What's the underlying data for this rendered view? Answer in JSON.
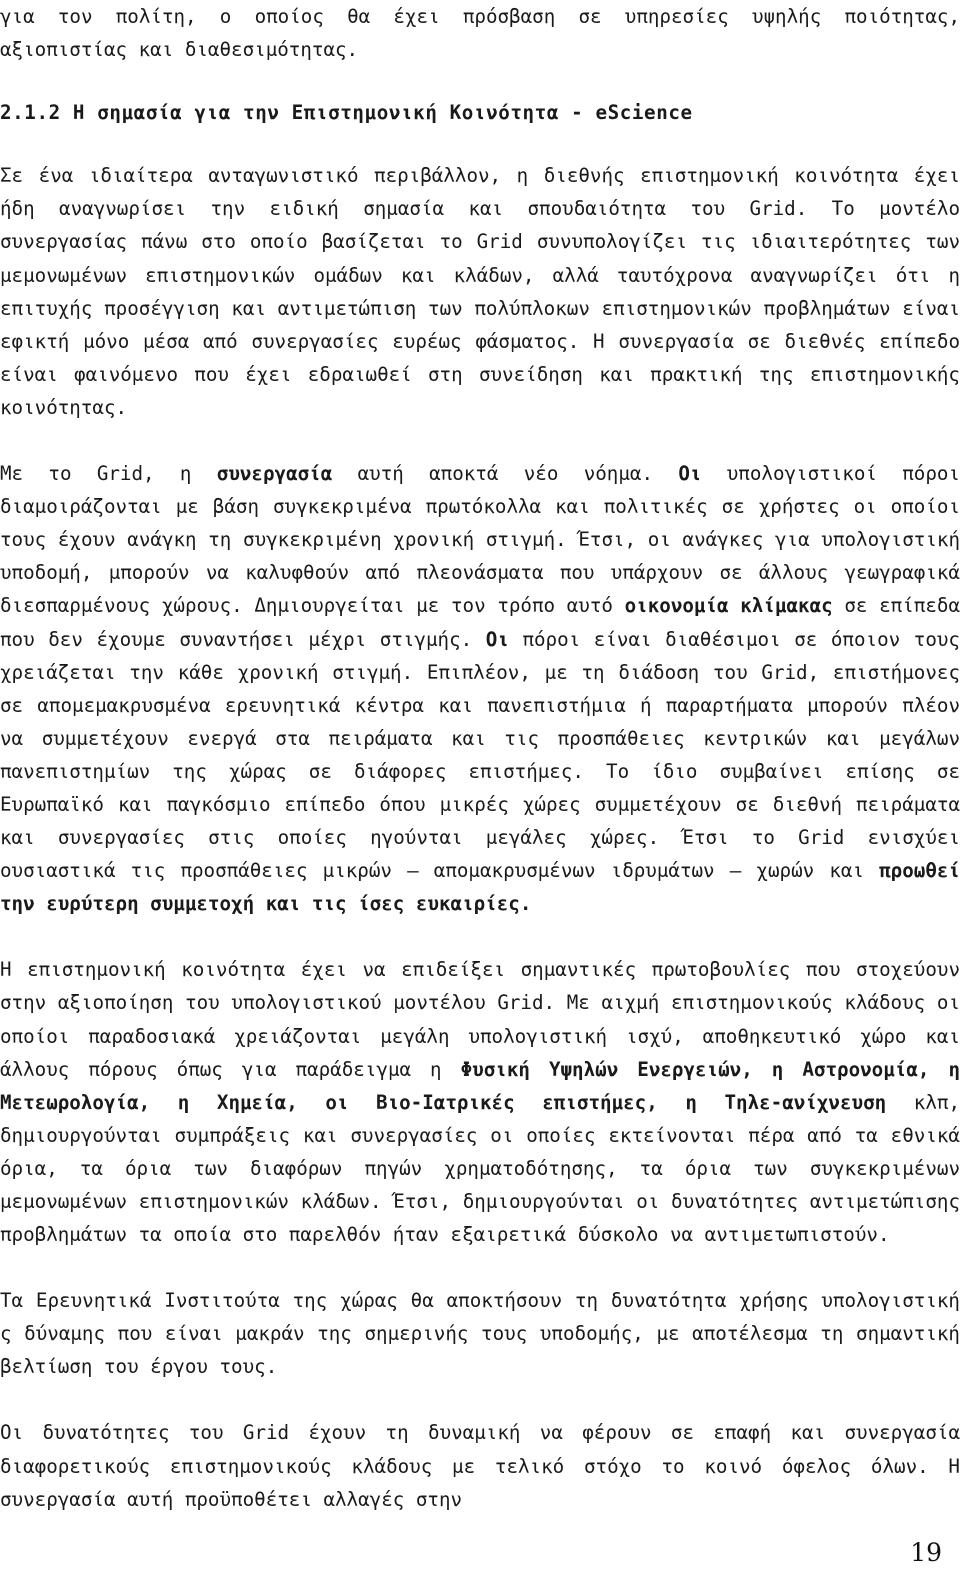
{
  "document": {
    "page_number": "19",
    "language": "el",
    "blocks": [
      {
        "id": "para_intro",
        "type": "paragraph",
        "justify_last_line": false,
        "text": "για τον πολίτη, ο οποίος θα έχει πρόσβαση σε υπηρεσίες υψηλής ποιότητας, αξιοπιστίας και διαθεσιμότητας."
      },
      {
        "id": "heading_212",
        "type": "heading",
        "number": "2.1.2",
        "text": "2.1.2 Η σημασία για την Επιστημονική Κοινότητα - eScience"
      },
      {
        "id": "para_1",
        "type": "paragraph",
        "justify_last_line": false,
        "text": "Σε ένα ιδιαίτερα ανταγωνιστικό περιβάλλον, η διεθνής επιστημονική κοινότητα έχει ήδη αναγνωρίσει την ειδική σημασία και σπουδαιότητα του Grid. Το μοντέλο συνεργασίας πάνω στο οποίο βασίζεται το Grid συνυπολογίζει τις ιδιαιτερότητες των μεμονωμένων επιστημονικών ομάδων και κλάδων, αλλά ταυτόχρονα αναγνωρίζει ότι η επιτυχής προσέγγιση και αντιμετώπιση των πολύπλοκων επιστημονικών προβλημάτων είναι εφικτή μόνο μέσα από συνεργασίες ευρέως φάσματος. Η συνεργασία σε διεθνές επίπεδο είναι φαινόμενο που έχει εδραιωθεί στη συνείδηση και πρακτική της επιστημονικής κοινότητας."
      },
      {
        "id": "para_2",
        "type": "paragraph_rich",
        "justify_last_line": false,
        "runs": [
          {
            "text": "Με το Grid, η ",
            "bold": false
          },
          {
            "text": "συνεργασία",
            "bold": true
          },
          {
            "text": " αυτή αποκτά νέο νόημα. ",
            "bold": false
          },
          {
            "text": "Οι",
            "bold": true
          },
          {
            "text": " υπολογιστικοί πόροι διαμοιράζονται με βάση συγκεκριμένα πρωτόκολλα και πολιτικές σε χρήστες οι οποίοι τους έχουν ανάγκη τη συγκεκριμένη χρονική στιγμή. Έτσι, οι ανάγκες για υπολογιστική υποδομή, μπορούν να καλυφθούν από πλεονάσματα που υπάρχουν σε άλλους γεωγραφικά διεσπαρμένους χώρους. Δημιουργείται με τον τρόπο αυτό ",
            "bold": false
          },
          {
            "text": "οικονομία κλίμακας",
            "bold": true
          },
          {
            "text": " σε επίπεδα που δεν έχουμε συναντήσει μέχρι στιγμής. ",
            "bold": false
          },
          {
            "text": "Οι",
            "bold": true
          },
          {
            "text": " πόροι είναι διαθέσιμοι σε όποιον τους χρειάζεται την κάθε χρονική στιγμή. Επιπλέον, με τη διάδοση του Grid, επιστήμονες σε απομεμακρυσμένα ερευνητικά κέντρα και πανεπιστήμια ή παραρτήματα μπορούν πλέον να συμμετέχουν ενεργά στα πειράματα και τις προσπάθειες κεντρικών και μεγάλων πανεπιστημίων της χώρας σε διάφορες επιστήμες. Το ίδιο συμβαίνει επίσης σε Ευρωπαϊκό και παγκόσμιο επίπεδο όπου μικρές χώρες συμμετέχουν σε διεθνή πειράματα και συνεργασίες στις οποίες ηγούνται μεγάλες χώρες. Έτσι το Grid ενισχύει ουσιαστικά τις προσπάθειες μικρών – απομακρυσμένων ιδρυμάτων – χωρών και ",
            "bold": false
          },
          {
            "text": "προωθεί την ευρύτερη συμμετοχή και τις ίσες ευκαιρίες.",
            "bold": true
          }
        ]
      },
      {
        "id": "para_3",
        "type": "paragraph_rich",
        "justify_last_line": false,
        "runs": [
          {
            "text": "Η επιστημονική κοινότητα έχει να επιδείξει σημαντικές πρωτοβουλίες που στοχεύουν στην αξιοποίηση του υπολογιστικού μοντέλου Grid. Με αιχμή επιστημονικούς κλάδους οι οποίοι παραδοσιακά χρειάζονται μεγάλη υπολογιστική ισχύ, αποθηκευτικό χώρο και άλλους πόρους όπως για παράδειγμα η ",
            "bold": false
          },
          {
            "text": "Φυσική Υψηλών Ενεργειών, η Αστρονομία, η Μετεωρολογία, η Χημεία, οι Βιο-Ιατρικές επιστήμες, η Τηλε-ανίχνευση",
            "bold": true
          },
          {
            "text": " κλπ, δημιουργούνται συμπράξεις και συνεργασίες οι οποίες εκτείνονται πέρα από τα εθνικά όρια, τα όρια των διαφόρων πηγών χρηματοδότησης, τα όρια των συγκεκριμένων μεμονωμένων επιστημονικών κλάδων. Έτσι, δημιουργούνται οι δυνατότητες αντιμετώπισης προβλημάτων τα οποία στο παρελθόν ήταν εξαιρετικά δύσκολο να αντιμετωπιστούν.",
            "bold": false
          }
        ]
      },
      {
        "id": "para_4",
        "type": "paragraph",
        "justify_last_line": false,
        "text": "Τα Ερευνητικά Ινστιτούτα της χώρας θα αποκτήσουν τη δυνατότητα χρήσης υπολογιστική ς δύναμης που είναι μακράν της σημερινής τους υποδομής, με αποτέλεσμα τη σημαντική βελτίωση του έργου τους."
      },
      {
        "id": "para_5",
        "type": "paragraph",
        "justify_last_line": false,
        "text": "Οι δυνατότητες του Grid έχουν τη δυναμική να φέρουν σε επαφή και συνεργασία διαφορετικούς επιστημονικούς κλάδους με τελικό στόχο το κοινό όφελος όλων. Η συνεργασία αυτή προϋποθέτει αλλαγές στην"
      }
    ]
  }
}
